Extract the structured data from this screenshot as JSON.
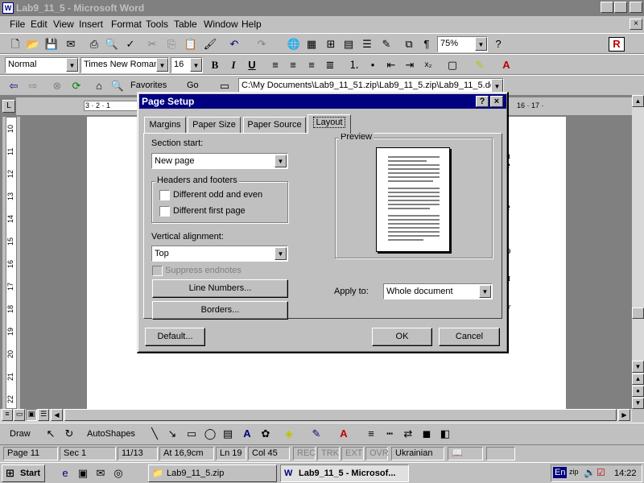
{
  "window": {
    "title": "Lab9_11_5 - Microsoft Word"
  },
  "menu": [
    "File",
    "Edit",
    "View",
    "Insert",
    "Format",
    "Tools",
    "Table",
    "Window",
    "Help"
  ],
  "formatting": {
    "style": "Normal",
    "font": "Times New Roman",
    "size": "16",
    "zoom": "75%",
    "bold": "B",
    "italic": "I",
    "underline": "U"
  },
  "web": {
    "favorites": "Favorites",
    "go": "Go",
    "address": "C:\\My Documents\\Lab9_11_51.zip\\Lab9_11_5.zip\\Lab9_11_5.doc"
  },
  "ruler": {
    "h_left": "3 · 2 · 1",
    "h_right": "16 · 17 ·",
    "v_marks": [
      "10",
      "11",
      "12",
      "13",
      "14",
      "15",
      "16",
      "17",
      "18",
      "19",
      "20",
      "21",
      "22"
    ]
  },
  "doc_fragments": [
    ",",
    "a",
    "e",
    "e",
    "o",
    "я",
    "y"
  ],
  "dialog": {
    "title": "Page Setup",
    "help": "?",
    "close": "×",
    "tabs": [
      "Margins",
      "Paper Size",
      "Paper Source",
      "Layout"
    ],
    "section_start_label": "Section start:",
    "section_start_value": "New page",
    "headers_footers_title": "Headers and footers",
    "diff_odd_even": "Different odd and even",
    "diff_first_page": "Different first page",
    "vertical_alignment_label": "Vertical alignment:",
    "vertical_alignment_value": "Top",
    "suppress_endnotes": "Suppress endnotes",
    "line_numbers": "Line Numbers...",
    "borders": "Borders...",
    "preview_title": "Preview",
    "apply_to_label": "Apply to:",
    "apply_to_value": "Whole document",
    "default": "Default...",
    "ok": "OK",
    "cancel": "Cancel"
  },
  "drawbar": {
    "draw": "Draw",
    "autoshapes": "AutoShapes"
  },
  "status": {
    "page": "Page 11",
    "sec": "Sec 1",
    "pages": "11/13",
    "at": "At 16,9cm",
    "ln": "Ln 19",
    "col": "Col 45",
    "rec": "REC",
    "trk": "TRK",
    "ext": "EXT",
    "ovr": "OVR",
    "lang": "Ukrainian"
  },
  "taskbar": {
    "start": "Start",
    "task1": "Lab9_11_5.zip",
    "task2": "Lab9_11_5 - Microsof...",
    "lang": "En",
    "time": "14:22"
  }
}
